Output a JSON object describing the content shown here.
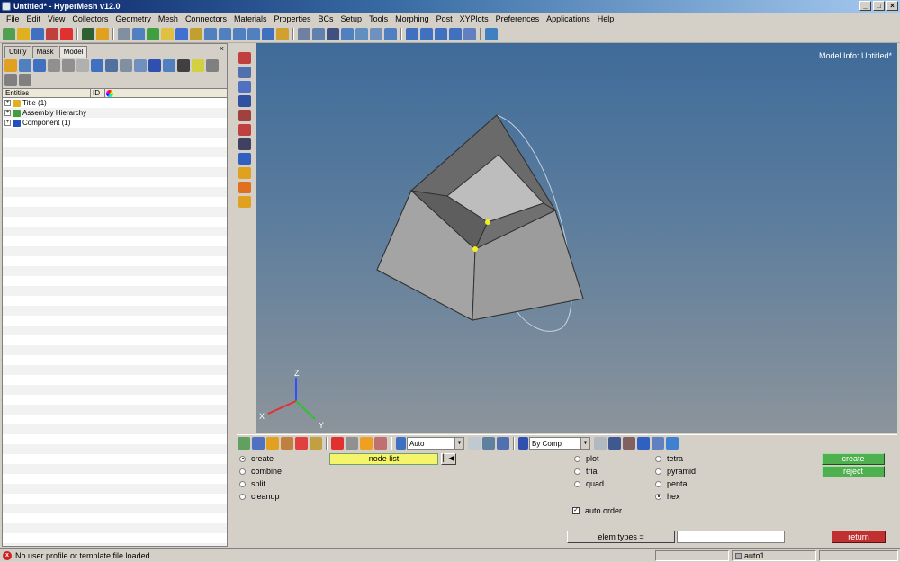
{
  "window": {
    "title": "Untitled* - HyperMesh v12.0",
    "controls": [
      "_",
      "□",
      "×"
    ]
  },
  "menu": [
    "File",
    "Edit",
    "View",
    "Collectors",
    "Geometry",
    "Mesh",
    "Connectors",
    "Materials",
    "Properties",
    "BCs",
    "Setup",
    "Tools",
    "Morphing",
    "Post",
    "XYPlots",
    "Preferences",
    "Applications",
    "Help"
  ],
  "browser": {
    "tabs": [
      "Utility",
      "Mask",
      "Model"
    ],
    "active_tab": "Model",
    "close": "×",
    "columns": [
      "Entities",
      "ID"
    ],
    "entities": [
      {
        "label": "Title (1)",
        "icon_color": "#e0b020"
      },
      {
        "label": "Assembly Hierarchy",
        "icon_color": "#40a040"
      },
      {
        "label": "Component (1)",
        "icon_color": "#2050c0"
      }
    ]
  },
  "viewport": {
    "model_info": "Model Info: Untitled*",
    "axes": {
      "x": "X",
      "y": "Y",
      "z": "Z"
    }
  },
  "bottom_toolbar": {
    "auto_select": "Auto",
    "color_mode": "By Comp"
  },
  "panel": {
    "modes": [
      {
        "label": "create",
        "selected": true
      },
      {
        "label": "combine",
        "selected": false
      },
      {
        "label": "split",
        "selected": false
      },
      {
        "label": "cleanup",
        "selected": false
      }
    ],
    "node_list": "node list",
    "reset_icon": "▏◀",
    "shape_types": [
      {
        "label": "plot",
        "selected": false
      },
      {
        "label": "tria",
        "selected": false
      },
      {
        "label": "quad",
        "selected": false
      }
    ],
    "solid_types": [
      {
        "label": "tetra",
        "selected": false
      },
      {
        "label": "pyramid",
        "selected": false
      },
      {
        "label": "penta",
        "selected": false
      },
      {
        "label": "hex",
        "selected": true
      }
    ],
    "auto_order": {
      "label": "auto order",
      "checked": true,
      "mark": "✓"
    },
    "create_button": "create",
    "reject_button": "reject",
    "elem_types_button": "elem types =",
    "elem_types_value": "",
    "return_button": "return"
  },
  "status": {
    "error_icon": "x",
    "message": "No user profile or template file loaded.",
    "collector": "auto1"
  }
}
